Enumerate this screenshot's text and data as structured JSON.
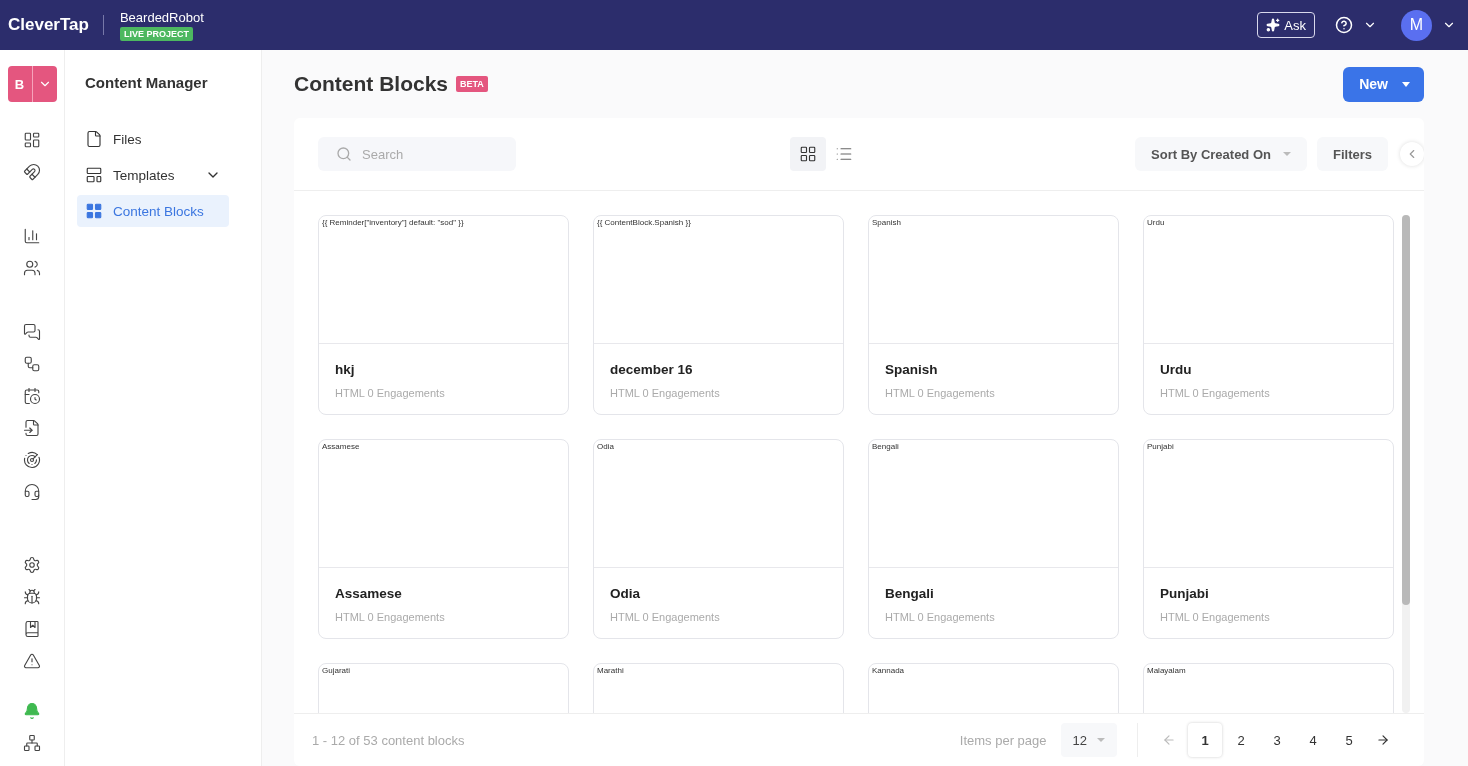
{
  "topbar": {
    "logo": "CleverTap",
    "project": "BeardedRobot",
    "project_badge": "LIVE PROJECT",
    "ask_label": "Ask",
    "avatar": "M"
  },
  "account": {
    "initial": "B"
  },
  "nav": {
    "title": "Content Manager",
    "items": [
      {
        "label": "Files",
        "selected": false,
        "expandable": false
      },
      {
        "label": "Templates",
        "selected": false,
        "expandable": true
      },
      {
        "label": "Content Blocks",
        "selected": true,
        "expandable": false
      }
    ]
  },
  "page": {
    "title": "Content Blocks",
    "badge": "BETA",
    "new_button": "New"
  },
  "toolbar": {
    "search": {
      "placeholder": "Search"
    },
    "views": [
      {
        "kind": "grid",
        "selected": true
      },
      {
        "kind": "list",
        "selected": false
      }
    ],
    "sort": "Sort By Created On",
    "filters": "Filters"
  },
  "cards": [
    {
      "preview": "{{ Reminder[\"inventory\"] default: \"sod\" }}",
      "name": "hkj",
      "meta": "HTML 0 Engagements"
    },
    {
      "preview": "{{ ContentBlock.Spanish }}",
      "name": "december 16",
      "meta": "HTML 0 Engagements"
    },
    {
      "preview": "Spanish",
      "name": "Spanish",
      "meta": "HTML 0 Engagements"
    },
    {
      "preview": "Urdu",
      "name": "Urdu",
      "meta": "HTML 0 Engagements"
    },
    {
      "preview": "Assamese",
      "name": "Assamese",
      "meta": "HTML 0 Engagements"
    },
    {
      "preview": "Odia",
      "name": "Odia",
      "meta": "HTML 0 Engagements"
    },
    {
      "preview": "Bengali",
      "name": "Bengali",
      "meta": "HTML 0 Engagements"
    },
    {
      "preview": "Punjabi",
      "name": "Punjabi",
      "meta": "HTML 0 Engagements"
    },
    {
      "preview": "Gujarati"
    },
    {
      "preview": "Marathi"
    },
    {
      "preview": "Kannada"
    },
    {
      "preview": "Malayalam"
    }
  ],
  "footer": {
    "summary": "1 - 12 of 53 content blocks",
    "per_page_label": "Items per page",
    "per_page": "12",
    "pages": [
      {
        "label": "1",
        "selected": true
      },
      {
        "label": "2",
        "selected": false
      },
      {
        "label": "3",
        "selected": false
      },
      {
        "label": "4",
        "selected": false
      },
      {
        "label": "5",
        "selected": false
      }
    ]
  }
}
